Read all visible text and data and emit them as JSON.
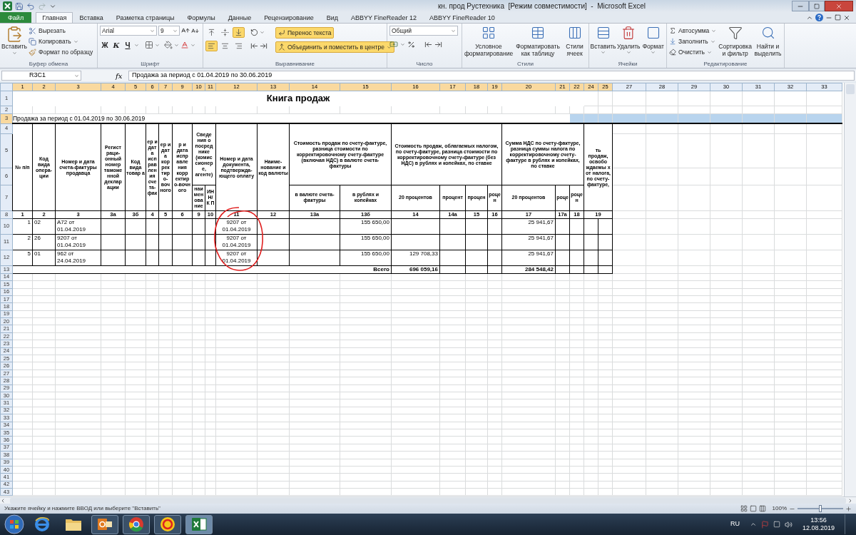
{
  "window": {
    "title": "кн. прод Рустехника  [Режим совместимости]  -  Microsoft Excel"
  },
  "ribbon_tabs": [
    {
      "label": "Файл",
      "kind": "file",
      "selected": false
    },
    {
      "label": "Главная",
      "kind": "tab",
      "selected": true
    },
    {
      "label": "Вставка",
      "kind": "tab",
      "selected": false
    },
    {
      "label": "Разметка страницы",
      "kind": "tab",
      "selected": false
    },
    {
      "label": "Формулы",
      "kind": "tab",
      "selected": false
    },
    {
      "label": "Данные",
      "kind": "tab",
      "selected": false
    },
    {
      "label": "Рецензирование",
      "kind": "tab",
      "selected": false
    },
    {
      "label": "Вид",
      "kind": "tab",
      "selected": false
    },
    {
      "label": "ABBYY FineReader 12",
      "kind": "tab",
      "selected": false
    },
    {
      "label": "ABBYY FineReader 10",
      "kind": "tab",
      "selected": false
    }
  ],
  "clipboard": {
    "label": "Буфер обмена",
    "paste": "Вставить",
    "cut": "Вырезать",
    "copy": "Копировать",
    "format_painter": "Формат по образцу"
  },
  "font": {
    "label": "Шрифт",
    "family": "Arial",
    "size": "9",
    "bold": "Ж",
    "italic": "К",
    "underline": "Ч"
  },
  "alignment": {
    "label": "Выравнивание",
    "wrap_text": {
      "label": "Перенос текста",
      "selected": true
    },
    "merge": {
      "label": "Объединить и поместить в центре",
      "selected": true
    },
    "vertical": [
      {
        "selected": false
      },
      {
        "selected": false
      },
      {
        "selected": true
      }
    ],
    "horizontal": [
      {
        "selected": true
      },
      {
        "selected": false
      },
      {
        "selected": false
      }
    ]
  },
  "number": {
    "label": "Число",
    "format": "Общий"
  },
  "styles": {
    "label": "Стили",
    "buttons": [
      "Условное форматирование",
      "Форматировать как таблицу",
      "Стили ячеек"
    ]
  },
  "cells": {
    "label": "Ячейки",
    "buttons": [
      "Вставить",
      "Удалить",
      "Формат"
    ]
  },
  "editing": {
    "label": "Редактирование",
    "autosum": "Автосумма",
    "fill": "Заполнить",
    "clear": "Очистить",
    "sort": "Сортировка и фильтр",
    "find": "Найти и выделить"
  },
  "formula_bar": {
    "name_box": "R3C1",
    "fx": "fx",
    "formula": "Продажа за период с 01.04.2019 по 30.06.2019"
  },
  "sheet": {
    "column_headers": [
      {
        "label": "1",
        "selected": true
      },
      {
        "label": "2",
        "selected": true
      },
      {
        "label": "3",
        "selected": true
      },
      {
        "label": "4",
        "selected": true
      },
      {
        "label": "5",
        "selected": true
      },
      {
        "label": "6",
        "selected": true
      },
      {
        "label": "7",
        "selected": true
      },
      {
        "label": "9",
        "selected": true
      },
      {
        "label": "10",
        "selected": true
      },
      {
        "label": "11",
        "selected": true
      },
      {
        "label": "12",
        "selected": true
      },
      {
        "label": "13",
        "selected": true
      },
      {
        "label": "14",
        "selected": true
      },
      {
        "label": "15",
        "selected": true
      },
      {
        "label": "16",
        "selected": true
      },
      {
        "label": "17",
        "selected": true
      },
      {
        "label": "18",
        "selected": true
      },
      {
        "label": "19",
        "selected": true
      },
      {
        "label": "20",
        "selected": true
      },
      {
        "label": "21",
        "selected": true
      },
      {
        "label": "22",
        "selected": true
      },
      {
        "label": "24",
        "selected": true
      },
      {
        "label": "25",
        "selected": true
      },
      {
        "label": "27",
        "selected": false
      },
      {
        "label": "28",
        "selected": false
      },
      {
        "label": "29",
        "selected": false
      },
      {
        "label": "30",
        "selected": false
      },
      {
        "label": "31",
        "selected": false
      },
      {
        "label": "32",
        "selected": false
      },
      {
        "label": "33",
        "selected": false
      }
    ],
    "row_headers": [
      {
        "label": "1",
        "selected": false
      },
      {
        "label": "2",
        "selected": false
      },
      {
        "label": "3",
        "selected": true
      },
      {
        "label": "4",
        "selected": false
      },
      {
        "label": "5",
        "selected": false
      },
      {
        "label": "6",
        "selected": false
      },
      {
        "label": "7",
        "selected": false
      },
      {
        "label": "8",
        "selected": false
      },
      {
        "label": "10",
        "selected": false
      },
      {
        "label": "11",
        "selected": false
      },
      {
        "label": "12",
        "selected": false
      },
      {
        "label": "13",
        "selected": false
      },
      {
        "label": "14",
        "selected": false
      },
      {
        "label": "15",
        "selected": false
      },
      {
        "label": "16",
        "selected": false
      },
      {
        "label": "17",
        "selected": false
      },
      {
        "label": "18",
        "selected": false
      },
      {
        "label": "19",
        "selected": false
      },
      {
        "label": "20",
        "selected": false
      },
      {
        "label": "21",
        "selected": false
      },
      {
        "label": "22",
        "selected": false
      },
      {
        "label": "23",
        "selected": false
      },
      {
        "label": "24",
        "selected": false
      },
      {
        "label": "25",
        "selected": false
      },
      {
        "label": "26",
        "selected": false
      },
      {
        "label": "27",
        "selected": false
      },
      {
        "label": "28",
        "selected": false
      },
      {
        "label": "29",
        "selected": false
      },
      {
        "label": "30",
        "selected": false
      },
      {
        "label": "31",
        "selected": false
      },
      {
        "label": "32",
        "selected": false
      },
      {
        "label": "33",
        "selected": false
      },
      {
        "label": "34",
        "selected": false
      },
      {
        "label": "35",
        "selected": false
      },
      {
        "label": "36",
        "selected": false
      },
      {
        "label": "37",
        "selected": false
      },
      {
        "label": "38",
        "selected": false
      },
      {
        "label": "39",
        "selected": false
      },
      {
        "label": "40",
        "selected": false
      },
      {
        "label": "41",
        "selected": false
      },
      {
        "label": "42",
        "selected": false
      },
      {
        "label": "43",
        "selected": false
      }
    ],
    "title": "Книга продаж",
    "period": "Продажа за период с 01.04.2019 по 30.06.2019",
    "header_columns": [
      {
        "title": "№ п/п"
      },
      {
        "title": "Код вида опера-ции"
      },
      {
        "title": "Номер и дата счета-фактуры продавца"
      },
      {
        "title": "Регист раци-онный номер таможе нной деклар ации"
      },
      {
        "title": "Код вида товар а"
      },
      {
        "title": "ер и дат а исп рав лен ия сче та-фак"
      },
      {
        "title": "ер и дат а кор рек тир о-воч ного"
      },
      {
        "title": "р и дата испр авле ния корр ектир о-вочн ого"
      },
      {
        "title": "Сведе ния о посред нике (комис сионер е, агенте)",
        "subcolumns": [
          "наи мен ова ние",
          "ИН Н/ К П"
        ]
      },
      {
        "title": "Номер и дата документа, подтвержда-ющего оплату"
      },
      {
        "title": "Наиме-нование и код валюты"
      },
      {
        "title": "Стоимость продаж по счету-фактуре, разница стоимости по корректировочному счету-фактуре (включая НДС) в валюте счета-фактуры",
        "subcolumns": [
          "в валюте счета-фактуры",
          "в рублях и копейках"
        ]
      },
      {
        "title": "Стоимость продаж, облагаемых налогом, по счету-фактуре, разница стоимости по корректировочному счету-фактуре (без НДС) в рублях и копейках, по ставке",
        "subcolumns": [
          "20 процентов",
          "процент",
          "процен",
          "роцен"
        ]
      },
      {
        "title": "Сумма НДС по счету-фактуре, разница суммы налога по корректировочному счету-фактуре в рублях и копейках, по ставке",
        "subcolumns": [
          "20 процентов",
          "роце",
          "роцен"
        ]
      },
      {
        "title": "ть продаж, освобо ждаемы х от налога, по счету-фактуре,"
      }
    ],
    "column_numbers": [
      "1",
      "2",
      "3",
      "3а",
      "3б",
      "4",
      "5",
      "6",
      "9",
      "10",
      "11",
      "12",
      "13а",
      "13б",
      "14",
      "14а",
      "15",
      "16",
      "17",
      "17а",
      "18",
      "19"
    ],
    "rows": [
      {
        "number": "1",
        "operation_code": "02",
        "invoice": "А72 от 01.04.2019",
        "payment_document": "9207 от 01.04.2019",
        "amount_rub": "155 650,00",
        "vat_20": "25 941,67"
      },
      {
        "number": "2",
        "operation_code": "26",
        "invoice": "9207 от 01.04.2019",
        "payment_document": "9207 от 01.04.2019",
        "amount_rub": "155 650,00",
        "vat_20": "25 941,67"
      },
      {
        "number": "5",
        "operation_code": "01",
        "invoice": "962 от 24.04.2019",
        "payment_document": "9207 от 01.04.2019",
        "amount_rub": "155 650,00",
        "amount_20": "129 708,33",
        "vat_20": "25 941,67"
      }
    ],
    "total": {
      "label": "Всего",
      "amount_20": "696 059,16",
      "vat_20": "284 548,42"
    }
  },
  "status_bar": {
    "message": "Укажите ячейку и нажмите ВВОД или выберите \"Вставить\"",
    "zoom": "100%",
    "zoom_slider": {
      "level": 0.5
    }
  },
  "taskbar": {
    "apps": [
      {
        "kind": "ie",
        "running": false,
        "selected": false
      },
      {
        "kind": "folder",
        "running": false,
        "selected": false
      },
      {
        "kind": "mail",
        "running": true,
        "selected": false
      },
      {
        "kind": "chrome",
        "running": true,
        "selected": false
      },
      {
        "kind": "onec",
        "running": true,
        "selected": false
      },
      {
        "kind": "excel",
        "running": true,
        "selected": true
      }
    ],
    "language": "RU",
    "time": "13:56",
    "date": "12.08.2019"
  }
}
